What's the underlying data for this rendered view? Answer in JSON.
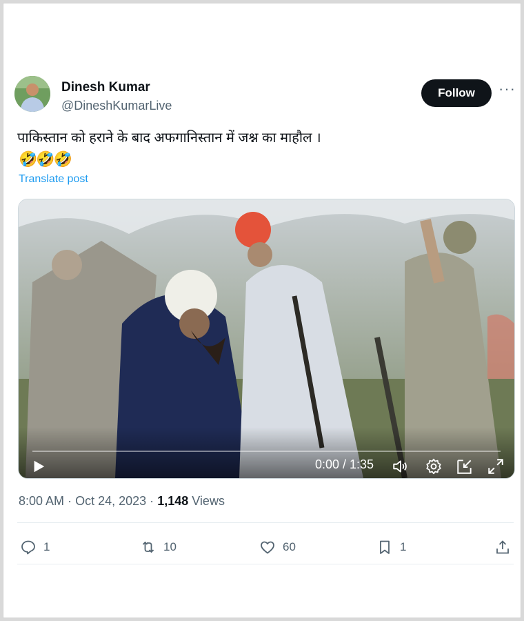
{
  "author": {
    "name": "Dinesh Kumar",
    "handle": "@DineshKumarLive",
    "follow_label": "Follow",
    "more_label": "···"
  },
  "post": {
    "text": "पाकिस्तान को हराने के बाद अफगानिस्तान में जश्न का माहौल ।",
    "emoji": "🤣🤣🤣",
    "translate_label": "Translate post"
  },
  "video": {
    "time_display": "0:00 / 1:35",
    "progress": 0.0
  },
  "meta": {
    "time": "8:00 AM",
    "date": "Oct 24, 2023",
    "views_count": "1,148",
    "views_label": "Views",
    "separator": "·"
  },
  "actions": {
    "replies": "1",
    "reposts": "10",
    "likes": "60",
    "bookmarks": "1"
  },
  "icons": [
    "avatar",
    "more-icon",
    "play-icon",
    "volume-icon",
    "settings-icon",
    "minimize-icon",
    "fullscreen-icon",
    "reply-icon",
    "repost-icon",
    "like-icon",
    "bookmark-icon",
    "share-icon"
  ],
  "colors": {
    "accent": "#1d9bf0",
    "text": "#0f1419",
    "muted": "#536471",
    "button": "#0f1419"
  }
}
